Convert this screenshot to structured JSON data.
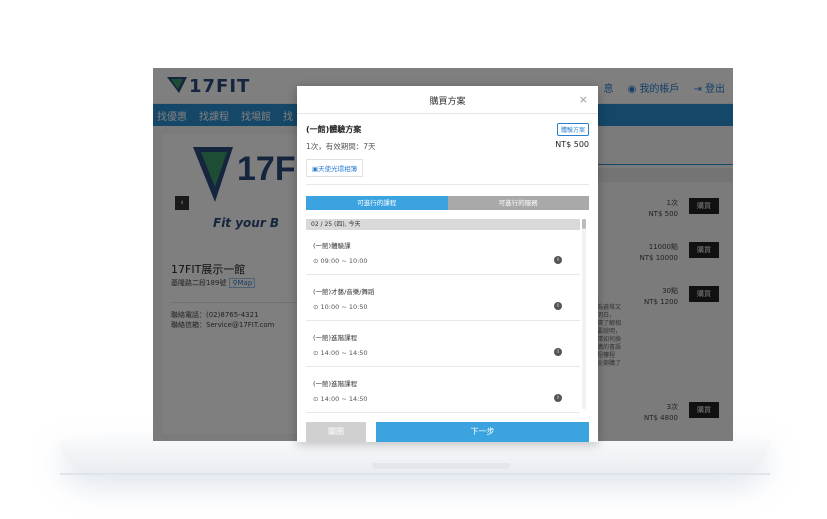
{
  "brand": {
    "logo_text": "17FIT",
    "tagline": "Fit your B"
  },
  "topbar": {
    "messages": "息",
    "my_account": "我的帳戶",
    "logout": "登出"
  },
  "nav": {
    "items": [
      "找優惠",
      "找課程",
      "找場館",
      "找"
    ]
  },
  "venue": {
    "name": "17FIT展示一館",
    "address": "基隆路二段189號",
    "map_label": "Map",
    "phone": "聯絡電話：(02)8765-4321",
    "email": "聯絡信箱：Service@17FIT.com"
  },
  "plans_list": [
    {
      "qty": "1次",
      "price": "NT$ 500",
      "buy": "購買"
    },
    {
      "qty": "11000點",
      "price": "NT$ 10000",
      "buy": "購買"
    },
    {
      "qty": "30點",
      "price": "NT$ 1200",
      "buy": "購買"
    },
    {
      "qty": "3次",
      "price": "NT$ 4800",
      "buy": "購買"
    }
  ],
  "side_desc": [
    "為避堆文",
    "明白，",
    "讀了解相",
    "要說明，",
    "請如何換",
    "購的書語",
    "程樓程",
    "全部購了"
  ],
  "modal": {
    "title": "購買方案",
    "close": "×",
    "plan_name": "(一館)體驗方案",
    "plan_badge": "體驗方案",
    "period": "1次，有效期間：7天",
    "price": "NT$ 500",
    "angel_link": "天使光環相簿",
    "tabs": [
      "可進行的課程",
      "可進行的服務"
    ],
    "date": "02 / 25 (四), 今天",
    "classes": [
      {
        "name": "(一館)體驗課",
        "time": "09:00 ~ 10:00"
      },
      {
        "name": "(一館)才藝/音樂/舞蹈",
        "time": "10:00 ~ 10:50"
      },
      {
        "name": "(一館)進階課程",
        "time": "14:00 ~ 14:50"
      },
      {
        "name": "(一館)進階課程",
        "time": "14:00 ~ 14:50"
      }
    ],
    "btn_close": "關閉",
    "btn_next": "下一步"
  },
  "colors": {
    "primary": "#3ba3e0",
    "nav": "#2b8fd1",
    "brand": "#2b4a7a",
    "accent_green": "#3a9d6a"
  }
}
